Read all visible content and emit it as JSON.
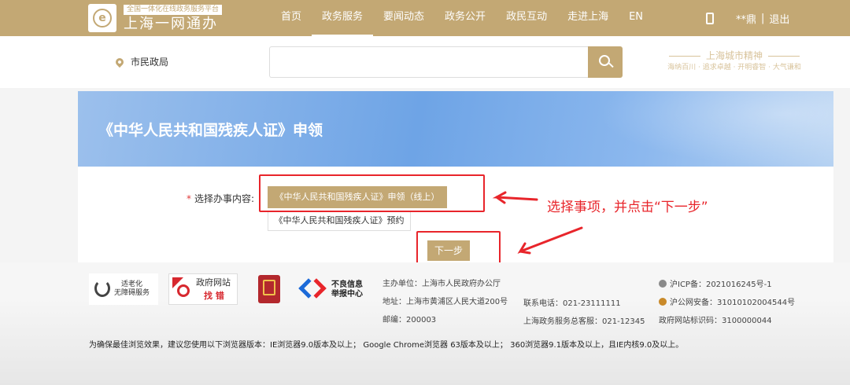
{
  "header": {
    "logo_sub": "全国一体化在线政务服务平台",
    "logo_main": "上海一网通办",
    "nav": [
      "首页",
      "政务服务",
      "要闻动态",
      "政务公开",
      "政民互动",
      "走进上海",
      "EN"
    ],
    "active_nav": "政务服务",
    "user": "**鼎",
    "separator": "|",
    "logout": "退出"
  },
  "search": {
    "location": "市民政局",
    "placeholder": "",
    "spirit_title": "上海城市精神",
    "spirit_sub": "海纳百川 · 追求卓越 · 开明睿智 · 大气谦和"
  },
  "banner": {
    "title": "《中华人民共和国残疾人证》申领"
  },
  "form": {
    "required_mark": "*",
    "label": "选择办事内容:",
    "options": [
      "《中华人民共和国残疾人证》申领（线上）",
      "《中华人民共和国残疾人证》预约"
    ],
    "selected_index": 0,
    "next_label": "下一步",
    "annotation": "选择事项，并点击“下一步”"
  },
  "colors": {
    "brand": "#c3a874",
    "annotation_red": "#e8252b",
    "banner_blue": "#6ea4e6"
  },
  "footer": {
    "badge_aged": [
      "适老化",
      "无障碍服务"
    ],
    "badge_gov": [
      "政府网站",
      "找 错"
    ],
    "badge_report": [
      "不良信息",
      "举报中心"
    ],
    "host": "主办单位：上海市人民政府办公厅",
    "address": "地址：上海市黄浦区人民大道200号",
    "postcode": "邮编：200003",
    "phone": "联系电话：021-23111111",
    "hotline": "上海政务服务总客服：021-12345",
    "icp": "沪ICP备：2021016245号-1",
    "police": "沪公网安备：31010102004544号",
    "site_id": "政府网站标识码：3100000044",
    "browser_tip": "为确保最佳浏览效果，建议您使用以下浏览器版本：IE浏览器9.0版本及以上；  Google Chrome浏览器 63版本及以上；  360浏览器9.1版本及以上，且IE内核9.0及以上。"
  }
}
